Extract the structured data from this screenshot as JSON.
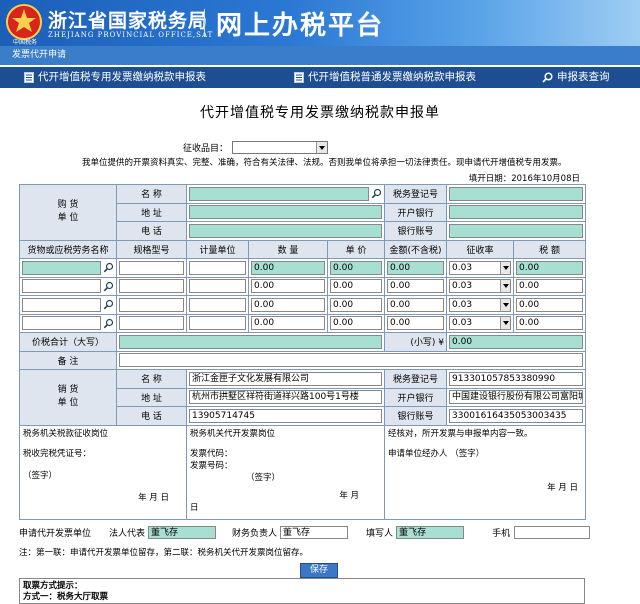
{
  "header": {
    "emblem_text": "中国税务",
    "brand_cn": "浙江省国家税务局",
    "brand_en": "ZHEJIANG PROVINCIAL OFFICE,SAT",
    "platform": "网上办税平台"
  },
  "subbar": {
    "label": "发票代开申请"
  },
  "nav": [
    {
      "label": "代开增值税专用发票缴纳税款申报表"
    },
    {
      "label": "代开增值税普通发票缴纳税款申报表"
    },
    {
      "label": "申报表查询"
    }
  ],
  "form": {
    "title": "代开增值税专用发票缴纳税款申报单",
    "tax_item_label": "征收品目：",
    "tax_item_value": "",
    "notice": "我单位提供的开票资料真实、完整、准确，符合有关法律、法规。否则我单位将承担一切法律责任。现申请代开增值税专用发票。",
    "fill_date": "填开日期：2016年10月08日"
  },
  "buyer": {
    "group_label_1": "购 货",
    "group_label_2": "单 位",
    "name_label": "名 称",
    "address_label": "地 址",
    "phone_label": "电 话",
    "tax_id_label": "税务登记号",
    "bank_label": "开户银行",
    "account_label": "银行账号",
    "name": "",
    "address": "",
    "phone": "",
    "tax_id": "",
    "bank": "",
    "account": ""
  },
  "items": {
    "headers": [
      "货物或应税劳务名称",
      "规格型号",
      "计量单位",
      "数 量",
      "单 价",
      "金额(不含税)",
      "征收率",
      "税 额"
    ],
    "rows": [
      {
        "name": "",
        "spec": "",
        "unit": "",
        "qty": "0.00",
        "price": "0.00",
        "amount": "0.00",
        "rate": "0.03",
        "tax": "0.00"
      },
      {
        "name": "",
        "spec": "",
        "unit": "",
        "qty": "0.00",
        "price": "0.00",
        "amount": "0.00",
        "rate": "0.03",
        "tax": "0.00"
      },
      {
        "name": "",
        "spec": "",
        "unit": "",
        "qty": "0.00",
        "price": "0.00",
        "amount": "0.00",
        "rate": "0.03",
        "tax": "0.00"
      },
      {
        "name": "",
        "spec": "",
        "unit": "",
        "qty": "0.00",
        "price": "0.00",
        "amount": "0.00",
        "rate": "0.03",
        "tax": "0.00"
      }
    ]
  },
  "total": {
    "label": "价税合计（大写）",
    "upper": "",
    "lower_label": "(小写) ¥",
    "lower_value": "0.00"
  },
  "remark": {
    "label": "备 注",
    "value": ""
  },
  "seller": {
    "group_label_1": "销 货",
    "group_label_2": "单 位",
    "name_label": "名 称",
    "address_label": "地 址",
    "phone_label": "电 话",
    "tax_id_label": "税务登记号",
    "bank_label": "开户银行",
    "account_label": "银行账号",
    "name": "浙江金匣子文化发展有限公司",
    "address": "杭州市拱墅区祥符街道祥兴路100号1号楼",
    "phone": "13905714745",
    "tax_id": "913301057853380990",
    "bank": "中国建设银行股份有限公司富阳城",
    "account": "33001616435053003435"
  },
  "signatures": {
    "col1_title": "税务机关税款征收岗位",
    "col1_voucher": "税收完税凭证号：",
    "col1_sign": "（签字）",
    "col1_date": "年  月  日",
    "col2_title": "税务机关代开发票岗位",
    "col2_code": "发票代码：",
    "col2_number": "发票号码：",
    "col2_sign": "（签字）",
    "col2_date": "年  月",
    "col2_day": "日",
    "col3_title": "经核对，所开发票与申报单内容一致。",
    "col3_agent": "申请单位经办人  （签字）",
    "col3_date": "年  月  日"
  },
  "bottom": {
    "applicant_label": "申请代开发票单位",
    "legal_label": "法人代表",
    "legal_value": "董飞存",
    "finance_label": "财务负责人",
    "finance_value": "董飞存",
    "filler_label": "填写人",
    "filler_value": "董飞存",
    "mobile_label": "手机",
    "mobile_value": ""
  },
  "footnote": "注：第一联：申请代开发票单位留存，第二联：税务机关代开发票岗位留存。",
  "save_button": "保存",
  "hint": {
    "title": "取票方式提示：",
    "method": "方式一：税务大厅取票"
  },
  "colors": {
    "header_blue": "#1b5fb8",
    "nav_dark": "#1d4e91",
    "field_teal": "#a7dfd2",
    "label_bg": "#dfe5ee"
  }
}
